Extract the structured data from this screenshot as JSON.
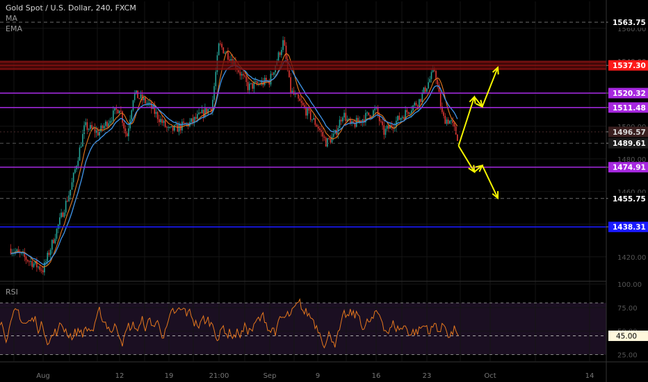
{
  "header": {
    "title": "Gold Spot / U.S. Dollar, 240, FXCM",
    "ind_ma": "MA",
    "ind_ema": "EMA",
    "rsi_label": "RSI"
  },
  "chart_data": [
    {
      "type": "candlestick",
      "title": "Gold Spot / U.S. Dollar, 240, FXCM",
      "ylim": [
        1405,
        1568
      ],
      "y_ticks": [
        1420.0,
        1440.0,
        1460.0,
        1480.0,
        1500.0,
        1520.0,
        1540.0,
        1560.0
      ],
      "x_ticks": [
        "Aug",
        "12",
        "19",
        "21:00",
        "Sep",
        "9",
        "16",
        "23",
        "Oct",
        "14"
      ],
      "price_path": [
        {
          "x": "Jul 29",
          "y": 1425
        },
        {
          "x": "Aug 1",
          "y": 1412
        },
        {
          "x": "Aug 5",
          "y": 1462
        },
        {
          "x": "Aug 7",
          "y": 1500
        },
        {
          "x": "Aug 9",
          "y": 1496
        },
        {
          "x": "Aug 12",
          "y": 1512
        },
        {
          "x": "Aug 13",
          "y": 1493
        },
        {
          "x": "Aug 14",
          "y": 1520
        },
        {
          "x": "Aug 16",
          "y": 1514
        },
        {
          "x": "Aug 19",
          "y": 1497
        },
        {
          "x": "Aug 22",
          "y": 1502
        },
        {
          "x": "Aug 25",
          "y": 1512
        },
        {
          "x": "Aug 26",
          "y": 1550
        },
        {
          "x": "Aug 28",
          "y": 1540
        },
        {
          "x": "Aug 30",
          "y": 1524
        },
        {
          "x": "Sep 2",
          "y": 1528
        },
        {
          "x": "Sep 4",
          "y": 1552
        },
        {
          "x": "Sep 5",
          "y": 1522
        },
        {
          "x": "Sep 9",
          "y": 1500
        },
        {
          "x": "Sep 10",
          "y": 1490
        },
        {
          "x": "Sep 11",
          "y": 1494
        },
        {
          "x": "Sep 12",
          "y": 1508
        },
        {
          "x": "Sep 13",
          "y": 1500
        },
        {
          "x": "Sep 16",
          "y": 1510
        },
        {
          "x": "Sep 17",
          "y": 1496
        },
        {
          "x": "Sep 19",
          "y": 1504
        },
        {
          "x": "Sep 22",
          "y": 1516
        },
        {
          "x": "Sep 24",
          "y": 1535
        },
        {
          "x": "Sep 25",
          "y": 1505
        },
        {
          "x": "Sep 26",
          "y": 1503
        },
        {
          "x": "Sep 27",
          "y": 1492
        }
      ],
      "horizontal_levels": [
        {
          "value": 1563.75,
          "label": "1563.75",
          "style": "dashed",
          "color": "#6b6b6b",
          "label_bg": "#000000",
          "label_color": "#ffffff"
        },
        {
          "value": 1537.3,
          "label": "1537.30",
          "style": "zone",
          "color": "#a31515",
          "label_bg": "#ff1a1a",
          "label_color": "#ffffff"
        },
        {
          "value": 1520.32,
          "label": "1520.32",
          "style": "solid",
          "color": "#9c27d6",
          "label_bg": "#a728e0",
          "label_color": "#ffffff"
        },
        {
          "value": 1511.48,
          "label": "1511.48",
          "style": "solid",
          "color": "#9c27d6",
          "label_bg": "#a728e0",
          "label_color": "#ffffff"
        },
        {
          "value": 1496.57,
          "label": "1496.57",
          "style": "dotted",
          "color": "#4a2b2b",
          "label_bg": "#3a1f1f",
          "label_color": "#d8d8d8"
        },
        {
          "value": 1489.61,
          "label": "1489.61",
          "style": "dashed",
          "color": "#555555",
          "label_bg": "#1b1b1b",
          "label_color": "#ffffff"
        },
        {
          "value": 1474.91,
          "label": "1474.91",
          "style": "solid",
          "color": "#9c27d6",
          "label_bg": "#a728e0",
          "label_color": "#ffffff"
        },
        {
          "value": 1455.75,
          "label": "1455.75",
          "style": "dashed",
          "color": "#6b6b6b",
          "label_bg": "#000000",
          "label_color": "#ffffff"
        },
        {
          "value": 1438.31,
          "label": "1438.31",
          "style": "solid",
          "color": "#1a1aff",
          "label_bg": "#1a1aff",
          "label_color": "#ffffff"
        }
      ],
      "projection_paths": [
        [
          {
            "x": "Sep 27",
            "y": 1488
          },
          {
            "x": "Sep 29",
            "y": 1518
          },
          {
            "x": "Sep 30",
            "y": 1512
          },
          {
            "x": "Oct 2",
            "y": 1536
          }
        ],
        [
          {
            "x": "Sep 27",
            "y": 1488
          },
          {
            "x": "Sep 29",
            "y": 1472
          },
          {
            "x": "Sep 30",
            "y": 1476
          },
          {
            "x": "Oct 2",
            "y": 1456
          }
        ]
      ],
      "colors": {
        "up": "#26a69a",
        "down": "#e53935",
        "ma": "#e6781e",
        "ema": "#3d8fe0",
        "projection": "#f5f500"
      }
    },
    {
      "type": "line",
      "title": "RSI",
      "ylim": [
        18,
        103
      ],
      "y_ticks": [
        25.0,
        50.0,
        75.0,
        100.0
      ],
      "band": [
        25,
        80
      ],
      "current_value": 45.0,
      "current_label": "45.00",
      "color": "#e6781e"
    }
  ]
}
